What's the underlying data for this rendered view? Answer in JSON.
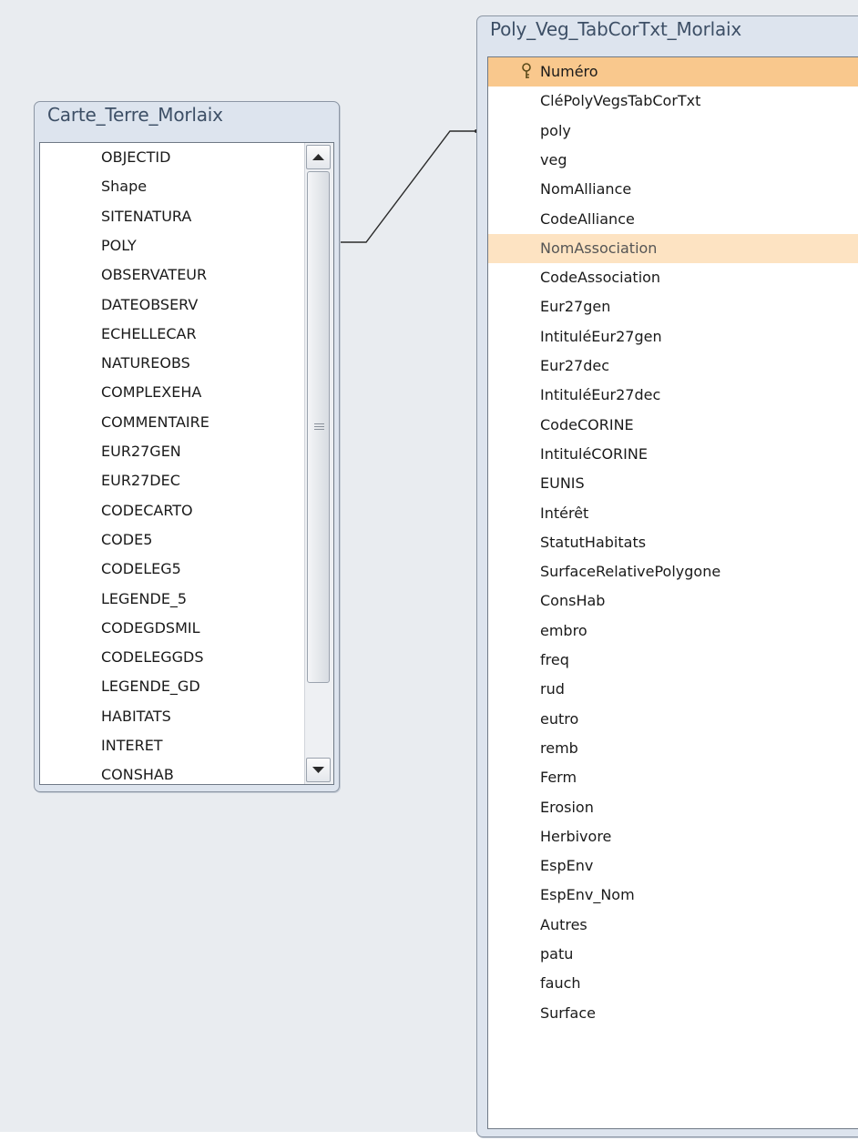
{
  "tables": [
    {
      "title": "Carte_Terre_Morlaix",
      "fields": [
        "OBJECTID",
        "Shape",
        "SITENATURA",
        "POLY",
        "OBSERVATEUR",
        "DATEOBSERV",
        "ECHELLECAR",
        "NATUREOBS",
        "COMPLEXEHA",
        "COMMENTAIRE",
        "EUR27GEN",
        "EUR27DEC",
        "CODECARTO",
        "CODE5",
        "CODELEG5",
        "LEGENDE_5",
        "CODEGDSMIL",
        "CODELEGGDS",
        "LEGENDE_GD",
        "HABITATS",
        "INTERET",
        "CONSHAB"
      ]
    },
    {
      "title": "Poly_Veg_TabCorTxt_Morlaix",
      "primary_key": "Numéro",
      "selected_field": "NomAssociation",
      "fields": [
        "Numéro",
        "CléPolyVegsTabCorTxt",
        "poly",
        "veg",
        "NomAlliance",
        "CodeAlliance",
        "NomAssociation",
        "CodeAssociation",
        "Eur27gen",
        "IntituléEur27gen",
        "Eur27dec",
        "IntituléEur27dec",
        "CodeCORINE",
        "IntituléCORINE",
        "EUNIS",
        "Intérêt",
        "StatutHabitats",
        "SurfaceRelativePolygone",
        "ConsHab",
        "embro",
        "freq",
        "rud",
        "eutro",
        "remb",
        "Ferm",
        "Erosion",
        "Herbivore",
        "EspEnv",
        "EspEnv_Nom",
        "Autres",
        "patu",
        "fauch",
        "Surface"
      ]
    }
  ],
  "relationship": {
    "from_field": "POLY",
    "to_field": "poly"
  },
  "icons": {
    "primary_key": "key-icon",
    "scroll_up": "arrow-up-icon",
    "scroll_down": "arrow-down-icon",
    "scroll_grip": "grip-icon"
  },
  "colors": {
    "surface": "#e9ecf0",
    "window_frame": "#dde4ee",
    "title_text": "#3d4f66",
    "primary_key_highlight": "#f9c88d",
    "selected_highlight": "#fde3c2"
  }
}
